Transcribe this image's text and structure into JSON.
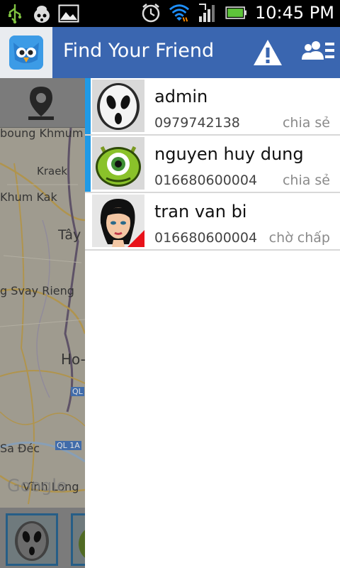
{
  "status_bar": {
    "time": "10:45 PM",
    "icons": [
      "usb-icon",
      "debug-bug-icon",
      "image-icon",
      "alarm-clock-icon",
      "wifi-icon",
      "signal-icon",
      "battery-icon"
    ]
  },
  "app_bar": {
    "title": "Find Your Friend",
    "logo_icon": "bird-logo-icon",
    "actions": [
      "warning-icon",
      "friends-list-icon"
    ]
  },
  "map": {
    "labels": [
      "boung Khmum",
      "Kraek",
      "Khum Kak",
      "Tây",
      "g Svay Rieng",
      "Ho-",
      "QL",
      "Sa Đéc",
      "QL 1A",
      "Vĩnh Long",
      "Google"
    ],
    "location_icon": "map-pin-icon"
  },
  "friends": [
    {
      "name": "admin",
      "phone": "0979742138",
      "status": "chia sẻ",
      "avatar": "ghost-mask-avatar",
      "active": true
    },
    {
      "name": "nguyen huy dung",
      "phone": "016680600004",
      "status": "chia sẻ",
      "avatar": "green-monster-avatar",
      "active": true
    },
    {
      "name": "tran van bi",
      "phone": "016680600004",
      "status": "chờ chấp",
      "avatar": "girl-cartoon-avatar",
      "active": false
    }
  ],
  "colors": {
    "app_bar": "#3a66b0",
    "active_indicator": "#1f9ae6",
    "pending_corner": "#e8121a"
  }
}
